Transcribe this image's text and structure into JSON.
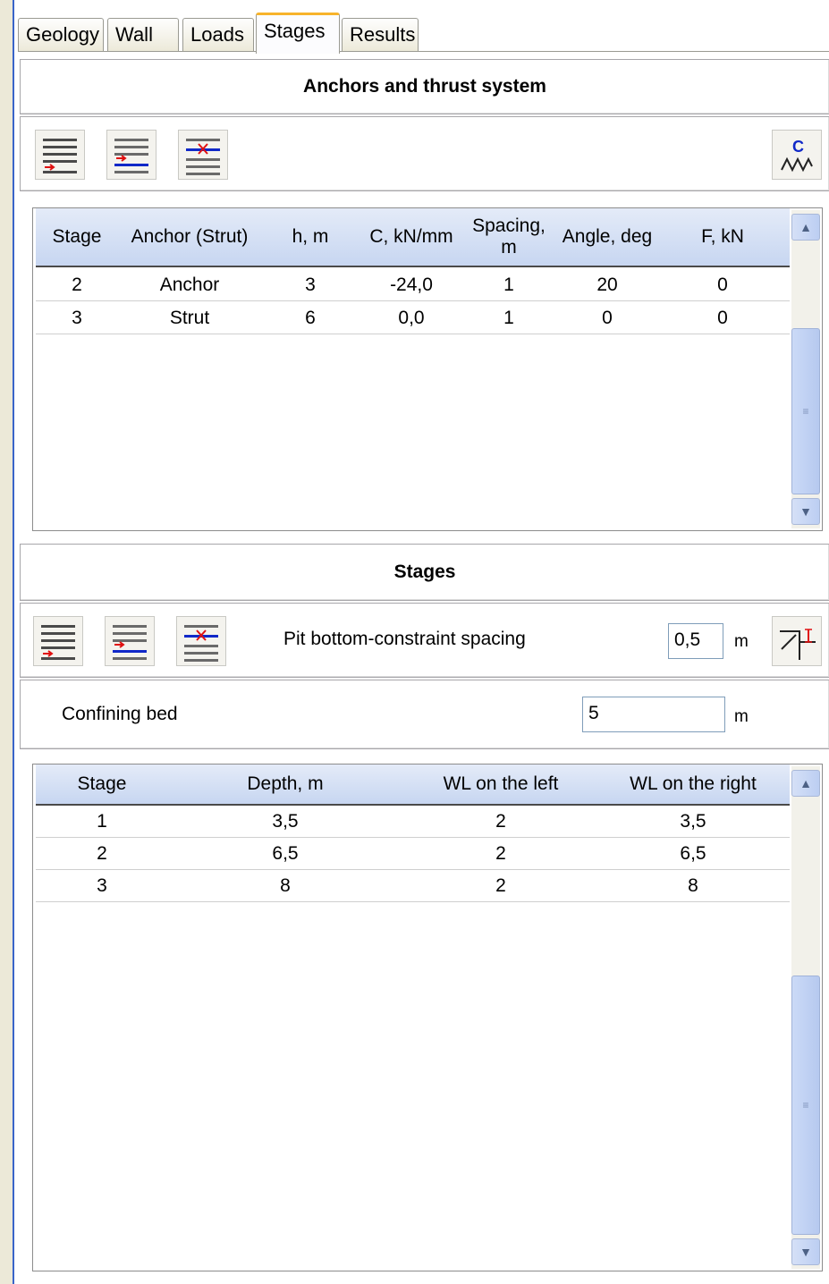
{
  "tabs": [
    {
      "label": "Geology"
    },
    {
      "label": "Wall"
    },
    {
      "label": "Loads"
    },
    {
      "label": "Stages"
    },
    {
      "label": "Results"
    }
  ],
  "anchors": {
    "title": "Anchors and thrust system",
    "columns": [
      "Stage",
      "Anchor (Strut)",
      "h, m",
      "C, kN/mm",
      "Spacing, m",
      "Angle, deg",
      "F, kN"
    ],
    "rows": [
      [
        "2",
        "Anchor",
        "3",
        "-24,0",
        "1",
        "20",
        "0"
      ],
      [
        "3",
        "Strut",
        "6",
        "0,0",
        "1",
        "0",
        "0"
      ]
    ]
  },
  "stages": {
    "title": "Stages",
    "pit_label": "Pit bottom-constraint spacing",
    "pit_value": "0,5",
    "pit_unit": "m",
    "confining_label": "Confining bed",
    "confining_value": "5",
    "confining_unit": "m",
    "columns": [
      "Stage",
      "Depth, m",
      "WL on the left",
      "WL on the right"
    ],
    "rows": [
      [
        "1",
        "3,5",
        "2",
        "3,5"
      ],
      [
        "2",
        "6,5",
        "2",
        "6,5"
      ],
      [
        "3",
        "8",
        "2",
        "8"
      ]
    ]
  },
  "icons": {
    "add_row": "add-row-icon",
    "insert_row": "insert-row-icon",
    "delete_row": "delete-row-icon",
    "stiffness": "spring-stiffness-icon",
    "pit_constraint": "pit-constraint-icon"
  },
  "colors": {
    "active_tab_accent": "#f7b32b",
    "header_blue": "#c7d6f1",
    "icon_red": "#e01010",
    "icon_blue": "#1028c8"
  }
}
